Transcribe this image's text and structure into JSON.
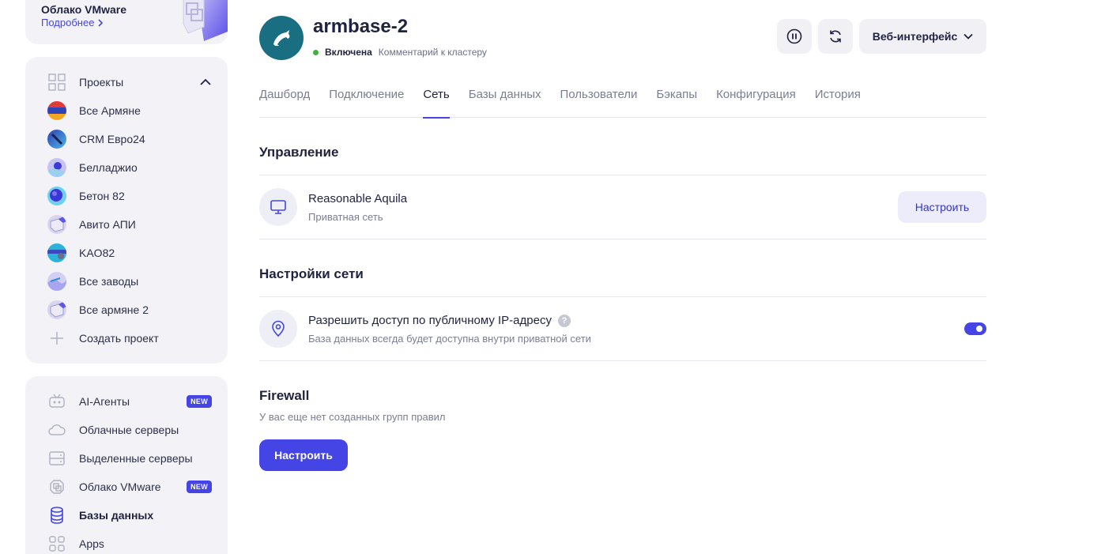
{
  "promo": {
    "title": "Облако VMware",
    "link_label": "Подробнее"
  },
  "sidebar": {
    "projects_header": "Проекты",
    "projects": [
      {
        "label": "Все Армяне",
        "avatar": "armenia-flag"
      },
      {
        "label": "CRM Евро24",
        "avatar": "blue-gradient"
      },
      {
        "label": "Белладжио",
        "avatar": "lilac-dot"
      },
      {
        "label": "Бетон 82",
        "avatar": "blue-sphere"
      },
      {
        "label": "Авито АПИ",
        "avatar": "cube"
      },
      {
        "label": "KAO82",
        "avatar": "teal-stripe"
      },
      {
        "label": "Все заводы",
        "avatar": "lilac-wave"
      },
      {
        "label": "Все армяне 2",
        "avatar": "cube"
      }
    ],
    "create_project": "Создать проект",
    "services": [
      {
        "label": "AI-Агенты",
        "icon": "robot-icon",
        "badge": "NEW"
      },
      {
        "label": "Облачные серверы",
        "icon": "cloud-icon",
        "badge": ""
      },
      {
        "label": "Выделенные серверы",
        "icon": "server-icon",
        "badge": ""
      },
      {
        "label": "Облако VMware",
        "icon": "vmware-icon",
        "badge": "NEW"
      },
      {
        "label": "Базы данных",
        "icon": "database-icon",
        "badge": ""
      },
      {
        "label": "Apps",
        "icon": "apps-icon",
        "badge": ""
      }
    ]
  },
  "header": {
    "title": "armbase-2",
    "status": "Включена",
    "comment_link": "Комментарий к кластеру",
    "web_button": "Веб-интерфейс"
  },
  "tabs": [
    "Дашборд",
    "Подключение",
    "Сеть",
    "Базы данных",
    "Пользователи",
    "Бэкапы",
    "Конфигурация",
    "История"
  ],
  "active_tab": "Сеть",
  "management": {
    "title": "Управление",
    "network_name": "Reasonable Aquila",
    "network_type": "Приватная сеть",
    "configure_label": "Настроить"
  },
  "network_settings": {
    "title": "Настройки сети",
    "public_access_label": "Разрешить доступ по публичному IP-адресу",
    "public_access_help": "?",
    "public_access_desc": "База данных всегда будет доступна внутри приватной сети",
    "public_access_enabled": true
  },
  "firewall": {
    "title": "Firewall",
    "empty_text": "У вас еще нет созданных групп правил",
    "configure_label": "Настроить"
  },
  "colors": {
    "accent": "#4545e5",
    "status_on": "#3cb43c",
    "logo_bg": "#196e82",
    "sidebar_bg": "#f3f3f7"
  }
}
